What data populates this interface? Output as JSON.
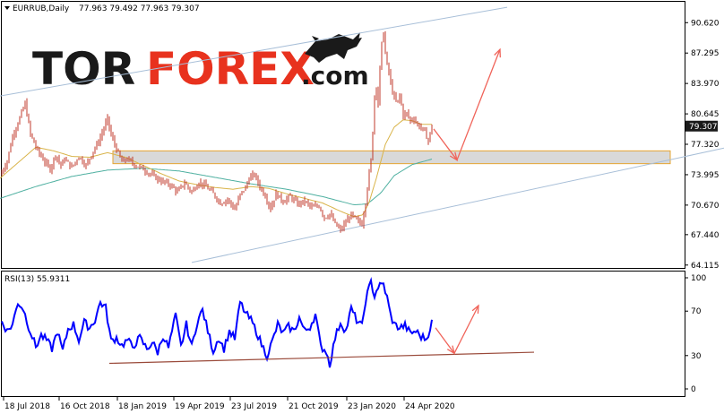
{
  "header": {
    "symbol": "EURRUB,Daily",
    "ohlc": "77.963 79.492 77.963 79.307",
    "triangle_icon": "dropdown-triangle-icon"
  },
  "logo": {
    "part1": "TOR",
    "part2": "FOREX",
    "part3": ".com",
    "icon": "bull-icon",
    "colors": {
      "tor": "#1a1a1a",
      "forex": "#e8321e",
      "com": "#1a1a1a"
    }
  },
  "chart_data": [
    {
      "type": "line",
      "title": "EURRUB,Daily",
      "ohlc_text": "77.963 79.492 77.963 79.307",
      "y_ticks": [
        "90.620",
        "87.295",
        "83.970",
        "80.645",
        "77.320",
        "73.995",
        "70.670",
        "67.440",
        "64.115"
      ],
      "y_tick_values": [
        90.62,
        87.295,
        83.97,
        80.645,
        77.32,
        73.995,
        70.67,
        67.44,
        64.115
      ],
      "ylim": [
        63.8,
        92.9
      ],
      "current_price": "79.307",
      "x_ticks": [
        "18 Jul 2018",
        "16 Oct 2018",
        "18 Jan 2019",
        "19 Apr 2019",
        "23 Jul 2019",
        "21 Oct 2019",
        "23 Jan 2020",
        "24 Apr 2020"
      ],
      "price_anchors": [
        [
          0,
          73.9
        ],
        [
          8,
          75.5
        ],
        [
          14,
          78.2
        ],
        [
          22,
          80.2
        ],
        [
          28,
          81.8
        ],
        [
          34,
          78.4
        ],
        [
          42,
          76.6
        ],
        [
          50,
          75.4
        ],
        [
          56,
          74.6
        ],
        [
          62,
          76.2
        ],
        [
          68,
          75.0
        ],
        [
          72,
          75.7
        ],
        [
          80,
          74.8
        ],
        [
          88,
          76.0
        ],
        [
          96,
          75.0
        ],
        [
          104,
          76.6
        ],
        [
          110,
          77.6
        ],
        [
          116,
          79.1
        ],
        [
          120,
          80.1
        ],
        [
          124,
          78.3
        ],
        [
          130,
          76.8
        ],
        [
          136,
          75.4
        ],
        [
          142,
          75.7
        ],
        [
          150,
          75.1
        ],
        [
          160,
          74.6
        ],
        [
          170,
          73.9
        ],
        [
          180,
          73.3
        ],
        [
          190,
          72.9
        ],
        [
          198,
          72.1
        ],
        [
          206,
          73.1
        ],
        [
          214,
          72.1
        ],
        [
          222,
          73.2
        ],
        [
          230,
          72.7
        ],
        [
          238,
          71.9
        ],
        [
          246,
          70.9
        ],
        [
          254,
          71.3
        ],
        [
          262,
          70.2
        ],
        [
          268,
          71.8
        ],
        [
          274,
          72.6
        ],
        [
          278,
          73.6
        ],
        [
          284,
          74.0
        ],
        [
          290,
          72.7
        ],
        [
          296,
          71.7
        ],
        [
          302,
          70.3
        ],
        [
          308,
          71.9
        ],
        [
          316,
          71.1
        ],
        [
          324,
          71.6
        ],
        [
          332,
          70.8
        ],
        [
          340,
          71.1
        ],
        [
          348,
          70.4
        ],
        [
          356,
          70.6
        ],
        [
          362,
          69.3
        ],
        [
          368,
          69.7
        ],
        [
          374,
          68.6
        ],
        [
          380,
          67.9
        ],
        [
          386,
          68.8
        ],
        [
          392,
          69.6
        ],
        [
          398,
          69.0
        ],
        [
          404,
          68.6
        ],
        [
          408,
          71.0
        ],
        [
          411,
          73.5
        ],
        [
          414,
          75.5
        ],
        [
          417,
          80.5
        ],
        [
          419,
          84.7
        ],
        [
          422,
          81.7
        ],
        [
          425,
          87.6
        ],
        [
          428,
          89.6
        ],
        [
          431,
          86.2
        ],
        [
          434,
          85.2
        ],
        [
          437,
          83.4
        ],
        [
          440,
          82.4
        ],
        [
          443,
          81.7
        ],
        [
          446,
          82.7
        ],
        [
          450,
          80.5
        ],
        [
          454,
          80.7
        ],
        [
          458,
          79.9
        ],
        [
          462,
          80.2
        ],
        [
          466,
          79.4
        ],
        [
          470,
          79.2
        ],
        [
          474,
          78.6
        ],
        [
          478,
          77.7
        ],
        [
          482,
          79.3
        ]
      ],
      "ma_fast_anchors": [
        [
          0,
          73.6
        ],
        [
          20,
          75.3
        ],
        [
          40,
          77.0
        ],
        [
          60,
          76.6
        ],
        [
          80,
          76.0
        ],
        [
          100,
          75.9
        ],
        [
          120,
          76.4
        ],
        [
          140,
          75.9
        ],
        [
          160,
          75.0
        ],
        [
          180,
          74.1
        ],
        [
          200,
          73.3
        ],
        [
          220,
          72.9
        ],
        [
          240,
          72.6
        ],
        [
          260,
          72.4
        ],
        [
          280,
          72.7
        ],
        [
          300,
          72.5
        ],
        [
          320,
          71.9
        ],
        [
          340,
          71.4
        ],
        [
          360,
          70.9
        ],
        [
          380,
          70.0
        ],
        [
          395,
          69.4
        ],
        [
          405,
          69.6
        ],
        [
          412,
          71.0
        ],
        [
          420,
          73.6
        ],
        [
          430,
          77.3
        ],
        [
          440,
          79.2
        ],
        [
          450,
          80.0
        ],
        [
          460,
          79.9
        ],
        [
          470,
          79.5
        ],
        [
          482,
          79.5
        ]
      ],
      "ma_slow_anchors": [
        [
          0,
          71.4
        ],
        [
          40,
          72.7
        ],
        [
          80,
          73.8
        ],
        [
          120,
          74.5
        ],
        [
          160,
          74.7
        ],
        [
          200,
          74.4
        ],
        [
          240,
          73.7
        ],
        [
          280,
          73.0
        ],
        [
          320,
          72.4
        ],
        [
          360,
          71.6
        ],
        [
          395,
          70.7
        ],
        [
          410,
          70.8
        ],
        [
          425,
          72.0
        ],
        [
          440,
          73.9
        ],
        [
          460,
          75.1
        ],
        [
          482,
          75.7
        ]
      ],
      "support_zone": {
        "from_price": 75.2,
        "to_price": 76.6
      },
      "channel_upper": [
        [
          0,
          82.6
        ],
        [
          566,
          92.3
        ]
      ],
      "channel_lower": [
        [
          214,
          64.4
        ],
        [
          808,
          76.9
        ]
      ],
      "forecast_arrow": [
        [
          484,
          79.0
        ],
        [
          510,
          75.6
        ],
        [
          558,
          87.7
        ]
      ],
      "grid": false,
      "colors": {
        "price": "#c0392b",
        "ma_fast": "#d9b44a",
        "ma_slow": "#4fb0a1",
        "channel": "#a8bfd8",
        "zone_fill": "#d9d9d9",
        "zone_border": "#e6a532",
        "arrow": "#f0645a",
        "current_label_bg": "#1a1a1a"
      }
    },
    {
      "type": "line",
      "title": "RSI(13) 55.9311",
      "y_ticks": [
        "100",
        "70",
        "30",
        "0"
      ],
      "y_tick_values": [
        100,
        70,
        30,
        0
      ],
      "ylim": [
        0,
        100
      ],
      "rsi_anchors": [
        [
          0,
          64
        ],
        [
          8,
          52
        ],
        [
          14,
          58
        ],
        [
          20,
          78
        ],
        [
          26,
          72
        ],
        [
          32,
          56
        ],
        [
          40,
          38
        ],
        [
          46,
          48
        ],
        [
          52,
          44
        ],
        [
          58,
          36
        ],
        [
          64,
          52
        ],
        [
          70,
          34
        ],
        [
          76,
          54
        ],
        [
          82,
          58
        ],
        [
          88,
          44
        ],
        [
          94,
          60
        ],
        [
          100,
          55
        ],
        [
          106,
          62
        ],
        [
          112,
          78
        ],
        [
          118,
          73
        ],
        [
          124,
          43
        ],
        [
          130,
          46
        ],
        [
          136,
          39
        ],
        [
          142,
          44
        ],
        [
          148,
          38
        ],
        [
          156,
          46
        ],
        [
          164,
          36
        ],
        [
          170,
          42
        ],
        [
          176,
          33
        ],
        [
          182,
          48
        ],
        [
          188,
          37
        ],
        [
          196,
          66
        ],
        [
          202,
          38
        ],
        [
          208,
          58
        ],
        [
          214,
          38
        ],
        [
          220,
          60
        ],
        [
          226,
          71
        ],
        [
          232,
          52
        ],
        [
          238,
          34
        ],
        [
          244,
          46
        ],
        [
          250,
          36
        ],
        [
          256,
          52
        ],
        [
          262,
          45
        ],
        [
          268,
          78
        ],
        [
          274,
          68
        ],
        [
          280,
          62
        ],
        [
          286,
          52
        ],
        [
          292,
          40
        ],
        [
          298,
          30
        ],
        [
          304,
          43
        ],
        [
          310,
          58
        ],
        [
          316,
          50
        ],
        [
          322,
          56
        ],
        [
          328,
          52
        ],
        [
          334,
          64
        ],
        [
          340,
          52
        ],
        [
          346,
          56
        ],
        [
          352,
          67
        ],
        [
          358,
          38
        ],
        [
          364,
          34
        ],
        [
          368,
          22
        ],
        [
          374,
          46
        ],
        [
          380,
          60
        ],
        [
          386,
          52
        ],
        [
          392,
          72
        ],
        [
          398,
          62
        ],
        [
          404,
          56
        ],
        [
          408,
          80
        ],
        [
          414,
          96
        ],
        [
          418,
          84
        ],
        [
          422,
          92
        ],
        [
          428,
          94
        ],
        [
          432,
          82
        ],
        [
          436,
          66
        ],
        [
          440,
          58
        ],
        [
          446,
          55
        ],
        [
          452,
          57
        ],
        [
          458,
          50
        ],
        [
          464,
          52
        ],
        [
          470,
          47
        ],
        [
          476,
          45
        ],
        [
          482,
          60
        ]
      ],
      "trendline": [
        [
          122,
          23
        ],
        [
          596,
          33
        ]
      ],
      "forecast_arrow": [
        [
          486,
          55
        ],
        [
          507,
          32
        ],
        [
          534,
          75
        ]
      ],
      "colors": {
        "rsi": "#0000ff",
        "trendline": "#9a4a3a",
        "arrow": "#f0645a"
      }
    }
  ]
}
